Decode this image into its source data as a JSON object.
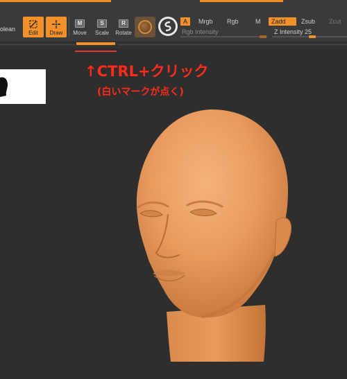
{
  "toolbar": {
    "truncated_label": "olean",
    "tools": [
      {
        "label": "Edit",
        "active": true
      },
      {
        "label": "Draw",
        "active": true
      },
      {
        "label": "Move",
        "key": "M",
        "active": false
      },
      {
        "label": "Scale",
        "key": "S",
        "active": false
      },
      {
        "label": "Rotate",
        "key": "R",
        "active": false
      }
    ],
    "channel_buttons": [
      {
        "label": "A",
        "active": true
      },
      {
        "label": "Mrgb",
        "active": false
      },
      {
        "label": "Rgb",
        "active": false
      },
      {
        "label": "M",
        "active": false
      },
      {
        "label": "Zadd",
        "active": true
      },
      {
        "label": "Zsub",
        "active": false
      },
      {
        "label": "Zcut",
        "active": false
      }
    ],
    "rgb_intensity_label": "Rgb Intensity",
    "z_intensity_label": "Z Intensity 25",
    "z_intensity_value": 25,
    "accent_color": "#f3902a"
  },
  "annotation": {
    "main": "↑CTRL+クリック",
    "sub": "(白いマークが点く)",
    "color": "#ff2a1a"
  },
  "viewport": {
    "background_color": "#2e2e2e",
    "model_color": "#e89a5c"
  }
}
